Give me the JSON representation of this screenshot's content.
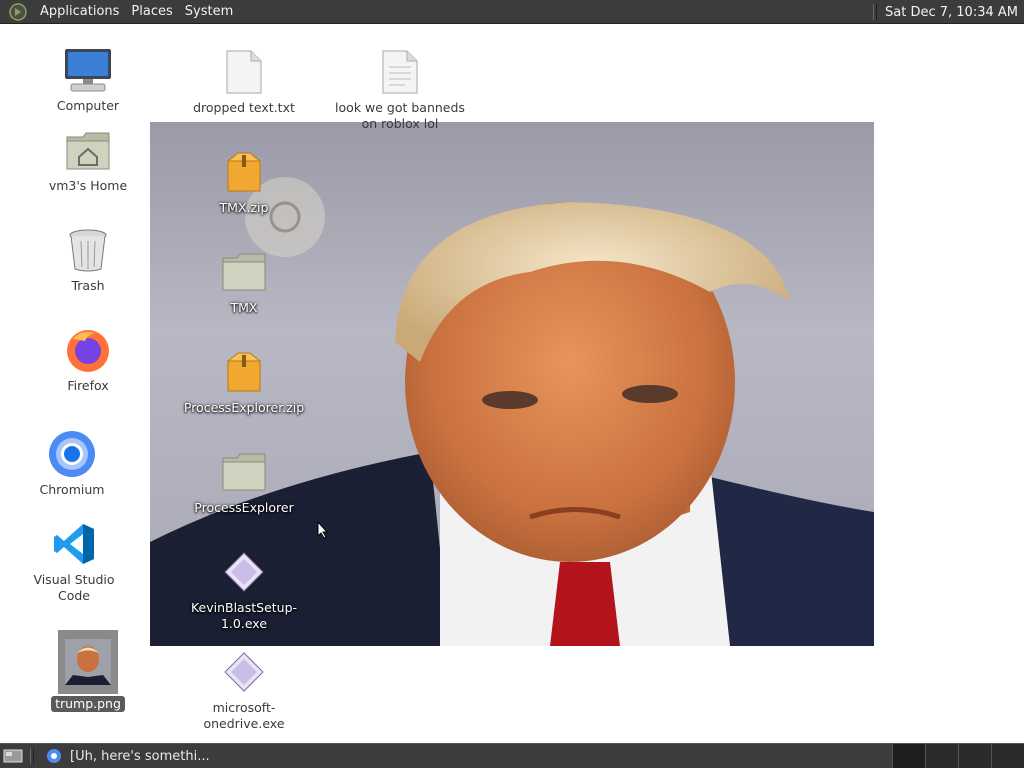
{
  "top_panel": {
    "menus": [
      "Applications",
      "Places",
      "System"
    ],
    "clock": "Sat Dec  7, 10:34 AM"
  },
  "desktop": {
    "left_icons": [
      {
        "label": "Computer",
        "icon": "computer-icon"
      },
      {
        "label": "vm3's Home",
        "icon": "home-folder-icon"
      },
      {
        "label": "Trash",
        "icon": "trash-icon"
      },
      {
        "label": "Firefox",
        "icon": "firefox-icon"
      },
      {
        "label": "Chromium",
        "icon": "chromium-icon"
      },
      {
        "label": "Visual Studio Code",
        "icon": "vscode-icon"
      },
      {
        "label": "trump.png",
        "icon": "image-thumbnail-icon"
      }
    ],
    "file_icons": [
      {
        "label": "dropped text.txt",
        "icon": "text-file-icon"
      },
      {
        "label": "look we got banneds on roblox lol",
        "icon": "text-file-icon"
      },
      {
        "label": "TMX.zip",
        "icon": "zip-archive-icon"
      },
      {
        "label": "TMX",
        "icon": "folder-icon"
      },
      {
        "label": "ProcessExplorer.zip",
        "icon": "zip-archive-icon"
      },
      {
        "label": "ProcessExplorer",
        "icon": "folder-icon"
      },
      {
        "label": "KevinBlastSetup-1.0.exe",
        "icon": "executable-icon"
      },
      {
        "label": "microsoft-onedrive.exe",
        "icon": "executable-icon"
      }
    ]
  },
  "bottom_panel": {
    "task_title": "[Uh, here's somethi..."
  },
  "colors": {
    "panel_bg": "#3c3c3c",
    "desktop_bg": "#ffffff",
    "selection_bg": "#5a5a5a"
  }
}
